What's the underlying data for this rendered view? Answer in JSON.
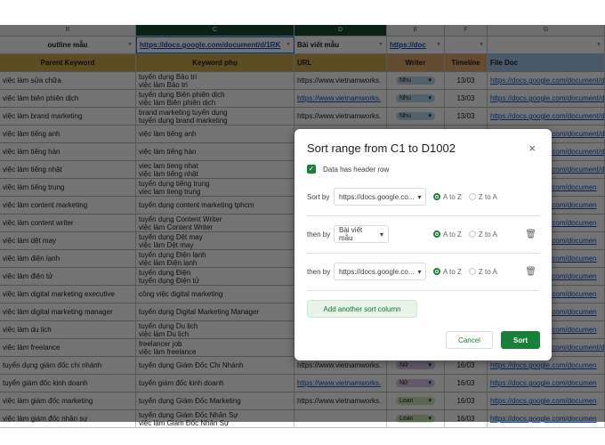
{
  "columns": [
    "B",
    "C",
    "D",
    "E",
    "F",
    "G"
  ],
  "filter_row": [
    "outline mẫu",
    "https://docs.google.com/document/d/1RK",
    "Bài viết mẫu",
    "https://doc",
    "",
    ""
  ],
  "header_row": [
    "Parent Keyword",
    "Keyword phụ",
    "URL",
    "Writer",
    "Timeline",
    "File Doc"
  ],
  "header_colors": [
    "#c9a84c",
    "#c9a84c",
    "#c9a84c",
    "#e0a86a",
    "#e0a86a",
    "#9fc5e8"
  ],
  "rows": [
    {
      "parent": "việc làm sửa chữa",
      "kw1": "tuyển dụng Bảo trì",
      "kw2": "việc làm Bảo trì",
      "url": "https://www.vietnamworks.",
      "writer": "Nhu",
      "timeline": "13/03",
      "doc": "https://docs.google.com/document/d/"
    },
    {
      "parent": "việc làm biên phiên dịch",
      "kw1": "tuyển dụng Biên phiên dịch",
      "kw2": "việc làm Biên phiên dịch",
      "url": "https://www.vietnamworks.",
      "writer": "Nhu",
      "timeline": "13/03",
      "doc": "https://docs.google.com/document/d/"
    },
    {
      "parent": "việc làm brand marketing",
      "kw1": "brand marketing tuyển dụng",
      "kw2": "tuyển dụng brand marketing",
      "url": "https://www.vietnamworks.",
      "writer": "Nhu",
      "timeline": "13/03",
      "doc": "https://docs.google.com/document/d/"
    },
    {
      "parent": "việc làm tiếng anh",
      "kw1": "việc làm tiếng anh",
      "kw2": "",
      "url": "",
      "writer": "",
      "timeline": "",
      "doc": "https://docs.google.com/document/d/"
    },
    {
      "parent": "việc làm tiếng hàn",
      "kw1": "việc làm tiếng hàn",
      "kw2": "",
      "url": "",
      "writer": "",
      "timeline": "",
      "doc": "https://docs.google.com/document/d/"
    },
    {
      "parent": "việc làm tiếng nhật",
      "kw1": "viec lam tieng nhat",
      "kw2": "việc làm tiếng nhật",
      "url": "",
      "writer": "",
      "timeline": "",
      "doc": "https://docs.google.com/document/d/"
    },
    {
      "parent": "việc làm tiếng trung",
      "kw1": "tuyển dụng tiếng trung",
      "kw2": "viec lam tieng trung",
      "url": "",
      "writer": "",
      "timeline": "",
      "doc": "https://docs.google.com/documen"
    },
    {
      "parent": "việc làm content marketing",
      "kw1": "tuyển dụng content marketing tphcm",
      "kw2": "",
      "url": "",
      "writer": "",
      "timeline": "",
      "doc": "https://docs.google.com/documen"
    },
    {
      "parent": "việc làm content writer",
      "kw1": "tuyển dụng Content Writer",
      "kw2": "việc làm Content Writer",
      "url": "",
      "writer": "",
      "timeline": "",
      "doc": "https://docs.google.com/documen"
    },
    {
      "parent": "việc làm dệt may",
      "kw1": "tuyển dụng Dệt may",
      "kw2": "việc làm Dệt may",
      "url": "",
      "writer": "",
      "timeline": "",
      "doc": "https://docs.google.com/documen"
    },
    {
      "parent": "việc làm điện lạnh",
      "kw1": "tuyển dụng Điện lạnh",
      "kw2": "việc làm Điện lạnh",
      "url": "",
      "writer": "",
      "timeline": "",
      "doc": "https://docs.google.com/documen"
    },
    {
      "parent": "việc làm điện tử",
      "kw1": "tuyển dụng Điện",
      "kw2": "tuyển dụng Điện tử",
      "url": "",
      "writer": "",
      "timeline": "",
      "doc": "https://docs.google.com/documen"
    },
    {
      "parent": "việc làm digital marketing executive",
      "kw1": "công việc digital marketing",
      "kw2": "",
      "url": "",
      "writer": "",
      "timeline": "",
      "doc": "https://docs.google.com/documen"
    },
    {
      "parent": "việc làm digital marketing manager",
      "kw1": "tuyển dụng Digital Marketing Manager",
      "kw2": "",
      "url": "",
      "writer": "",
      "timeline": "",
      "doc": "https://docs.google.com/documen"
    },
    {
      "parent": "việc làm du lịch",
      "kw1": "tuyển dụng Du lịch",
      "kw2": "việc làm Du lịch",
      "url": "",
      "writer": "",
      "timeline": "",
      "doc": "https://docs.google.com/documen"
    },
    {
      "parent": "việc làm freelance",
      "kw1": "freelancer job",
      "kw2": "việc làm freelance",
      "url": "",
      "writer": "",
      "timeline": "",
      "doc": "https://docs.google.com/document/d/"
    },
    {
      "parent": "tuyển dụng giám đốc chi nhánh",
      "kw1": "tuyển dụng Giám Đốc Chi Nhánh",
      "kw2": "",
      "url": "https://www.vietnamworks.",
      "writer": "Nữ",
      "timeline": "16/03",
      "doc": "https://docs.google.com/documen"
    },
    {
      "parent": "tuyển giám đốc kinh doanh",
      "kw1": "tuyển giám đốc kinh doanh",
      "kw2": "",
      "url": "https://www.vietnamworks.",
      "writer": "Nữ",
      "timeline": "16/03",
      "doc": "https://docs.google.com/documen"
    },
    {
      "parent": "việc làm giám đốc marketing",
      "kw1": "tuyển dụng Giám Đốc Marketing",
      "kw2": "",
      "url": "https://www.vietnamworks.",
      "writer": "Loan",
      "timeline": "16/03",
      "doc": "https://docs.google.com/documen"
    },
    {
      "parent": "việc làm giám đốc nhân sự",
      "kw1": "tuyển dụng Giám Đốc Nhân Sự",
      "kw2": "việc làm Giám Đốc Nhân Sự",
      "url": "",
      "writer": "Loan",
      "timeline": "16/03",
      "doc": "https://docs.google.com/documen"
    }
  ],
  "writer_colors": {
    "Nhu": "#b7d7e8",
    "Nữ": "#d9c3e8",
    "Loan": "#c9e5b9"
  },
  "dialog": {
    "title": "Sort range from C1 to D1002",
    "close_icon": "×",
    "header_checkbox_label": "Data has header row",
    "header_checked": true,
    "rules": [
      {
        "label": "Sort by",
        "column": "https://docs.google.co...",
        "order": "A to Z",
        "deletable": false
      },
      {
        "label": "then by",
        "column": "Bài viết mẫu",
        "order": "A to Z",
        "deletable": true
      },
      {
        "label": "then by",
        "column": "https://docs.google.co...",
        "order": "A to Z",
        "deletable": true
      }
    ],
    "order_a": "A to Z",
    "order_z": "Z to A",
    "add_label": "Add another sort column",
    "cancel_label": "Cancel",
    "sort_label": "Sort"
  }
}
